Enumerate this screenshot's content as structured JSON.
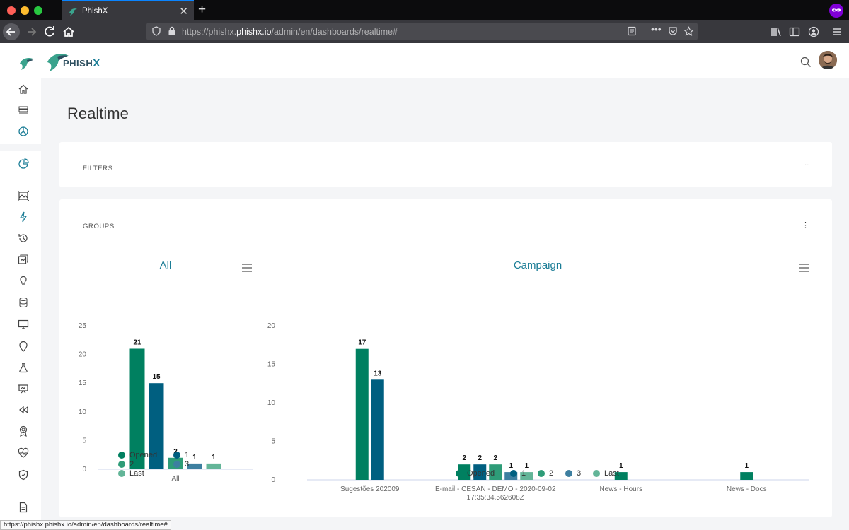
{
  "browser": {
    "tab_title": "PhishX",
    "url_prefix": "https://phishx.",
    "url_domain": "phishx.io",
    "url_path": "/admin/en/dashboards/realtime#",
    "status_url": "https://phishx.phishx.io/admin/en/dashboards/realtime#"
  },
  "app": {
    "brand_main": "PHISH",
    "brand_x": "X",
    "page_title": "Realtime",
    "filters_label": "FILTERS",
    "filters_menu": "···",
    "groups_label": "GROUPS",
    "groups_menu": "⋮"
  },
  "sidebar": {
    "icons": [
      "home-icon",
      "list-icon",
      "dashboard-icon",
      "chart-pie-icon",
      "image-icon",
      "lightning-icon",
      "history-icon",
      "image-chart-icon",
      "lightbulb-icon",
      "database-icon",
      "monitor-icon",
      "map-pin-icon",
      "flask-icon",
      "presentation-icon",
      "rewind-icon",
      "award-icon",
      "heartbeat-icon",
      "shield-icon",
      "document-icon"
    ]
  },
  "colors": {
    "opened": "#008060",
    "s1": "#005f80",
    "s2": "#2e9c78",
    "s3": "#3d7fa0",
    "last": "#63b598",
    "accent": "#1b7d96"
  },
  "chart_data": [
    {
      "type": "bar",
      "title": "All",
      "categories": [
        "All"
      ],
      "series": [
        {
          "name": "Opened",
          "values": [
            21
          ]
        },
        {
          "name": "1",
          "values": [
            15
          ]
        },
        {
          "name": "2",
          "values": [
            2
          ]
        },
        {
          "name": "3",
          "values": [
            1
          ]
        },
        {
          "name": "Last",
          "values": [
            1
          ]
        }
      ],
      "ylim": [
        0,
        25
      ],
      "yticks": [
        0,
        5,
        10,
        15,
        20,
        25
      ],
      "legend": "bottom"
    },
    {
      "type": "bar",
      "title": "Campaign",
      "categories": [
        "Sugestões 202009",
        "E-mail - CESAN - DEMO - 2020-09-02 17:35:34.562608Z",
        "News - Hours",
        "News - Docs"
      ],
      "category_lines": [
        [
          "Sugestões 202009"
        ],
        [
          "E-mail - CESAN - DEMO - 2020-09-02",
          "17:35:34.562608Z"
        ],
        [
          "News - Hours"
        ],
        [
          "News - Docs"
        ]
      ],
      "series": [
        {
          "name": "Opened",
          "values": [
            17,
            2,
            1,
            1
          ]
        },
        {
          "name": "1",
          "values": [
            13,
            2,
            null,
            null
          ]
        },
        {
          "name": "2",
          "values": [
            null,
            2,
            null,
            null
          ]
        },
        {
          "name": "3",
          "values": [
            null,
            1,
            null,
            null
          ]
        },
        {
          "name": "Last",
          "values": [
            null,
            1,
            null,
            null
          ]
        }
      ],
      "ylim": [
        0,
        20
      ],
      "yticks": [
        0,
        5,
        10,
        15,
        20
      ],
      "legend": "bottom"
    }
  ]
}
